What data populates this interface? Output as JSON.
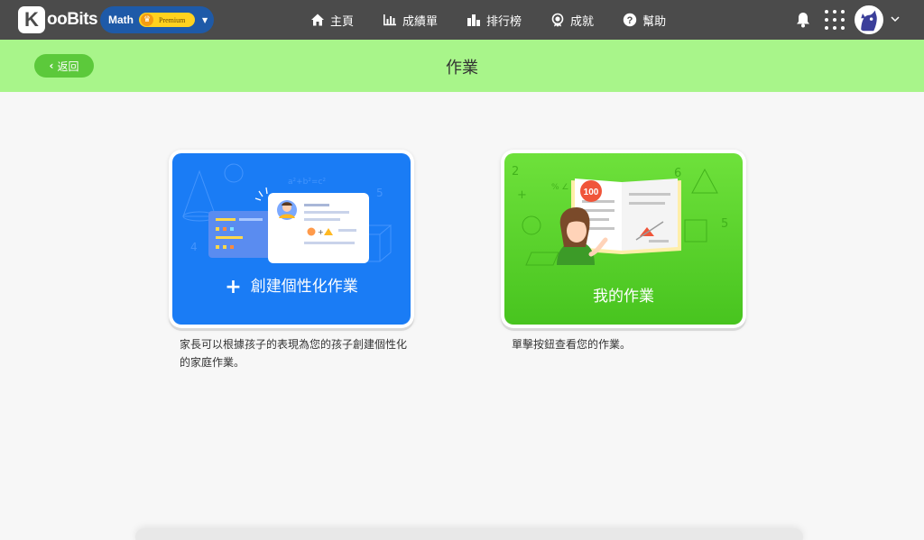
{
  "brand": {
    "logo_letter": "K",
    "logo_text": "ooBits"
  },
  "subject": {
    "label": "Math",
    "badge": "Premium"
  },
  "nav": [
    {
      "label": "主頁",
      "icon": "home-icon"
    },
    {
      "label": "成績單",
      "icon": "bar-chart-icon"
    },
    {
      "label": "排行榜",
      "icon": "leaderboard-icon"
    },
    {
      "label": "成就",
      "icon": "medal-icon"
    },
    {
      "label": "幫助",
      "icon": "help-icon"
    }
  ],
  "subheader": {
    "back_label": "返回",
    "title": "作業"
  },
  "cards": [
    {
      "label": "創建個性化作業",
      "description": "家長可以根據孩子的表現為您的孩子創建個性化的家庭作業。"
    },
    {
      "label": "我的作業",
      "description": "單擊按鈕查看您的作業。",
      "badge": "100"
    }
  ],
  "colors": {
    "topbar": "#4b4b4b",
    "subheader": "#a8f58a",
    "back_button": "#5cc93b",
    "subject_pill": "#1e5aa8",
    "card_blue": "#1a7cf5",
    "card_green": "#48c41f"
  }
}
